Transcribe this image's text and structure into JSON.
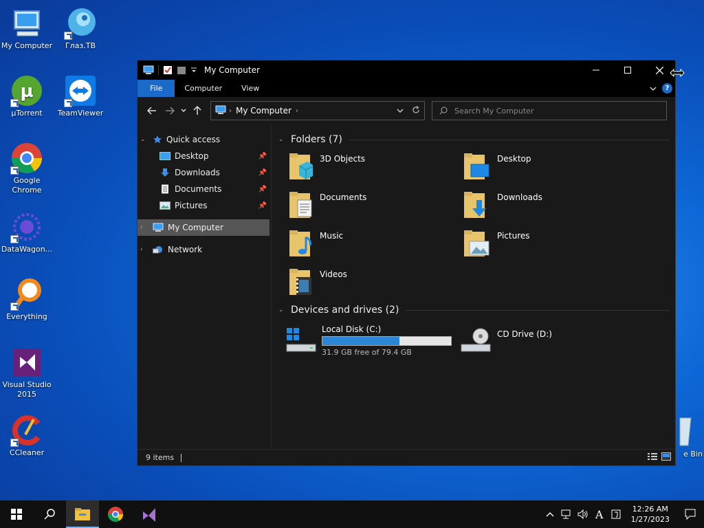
{
  "desktop": {
    "icons": [
      {
        "label": "My Computer"
      },
      {
        "label": "Глаз.ТВ"
      },
      {
        "label": "µTorrent"
      },
      {
        "label": "TeamViewer"
      },
      {
        "label": "Google Chrome"
      },
      {
        "label": "DataWagon..."
      },
      {
        "label": "Everything"
      },
      {
        "label": "Visual Studio 2015"
      },
      {
        "label": "CCleaner"
      },
      {
        "label": "e Bin"
      }
    ]
  },
  "window": {
    "title": "My Computer",
    "ribbon_tabs": [
      "File",
      "Computer",
      "View"
    ],
    "help": "?",
    "address": {
      "crumb": "My Computer"
    },
    "search_placeholder": "Search My Computer",
    "nav": {
      "quick_access": "Quick access",
      "quick_items": [
        "Desktop",
        "Downloads",
        "Documents",
        "Pictures"
      ],
      "my_computer": "My Computer",
      "network": "Network"
    },
    "folders_header": "Folders (7)",
    "folders": [
      "3D Objects",
      "Desktop",
      "Documents",
      "Downloads",
      "Music",
      "Pictures",
      "Videos"
    ],
    "drives_header": "Devices and drives (2)",
    "drives": [
      {
        "name": "Local Disk (C:)",
        "free_text": "31.9 GB free of 79.4 GB",
        "used_fraction": 0.6
      },
      {
        "name": "CD Drive (D:)"
      }
    ],
    "status": "9 items"
  },
  "taskbar": {
    "time": "12:26 AM",
    "date": "1/27/2023",
    "lang": "A"
  },
  "colors": {
    "accent": "#1b6ac9",
    "window_bg": "#191919",
    "titlebar": "#000000"
  }
}
